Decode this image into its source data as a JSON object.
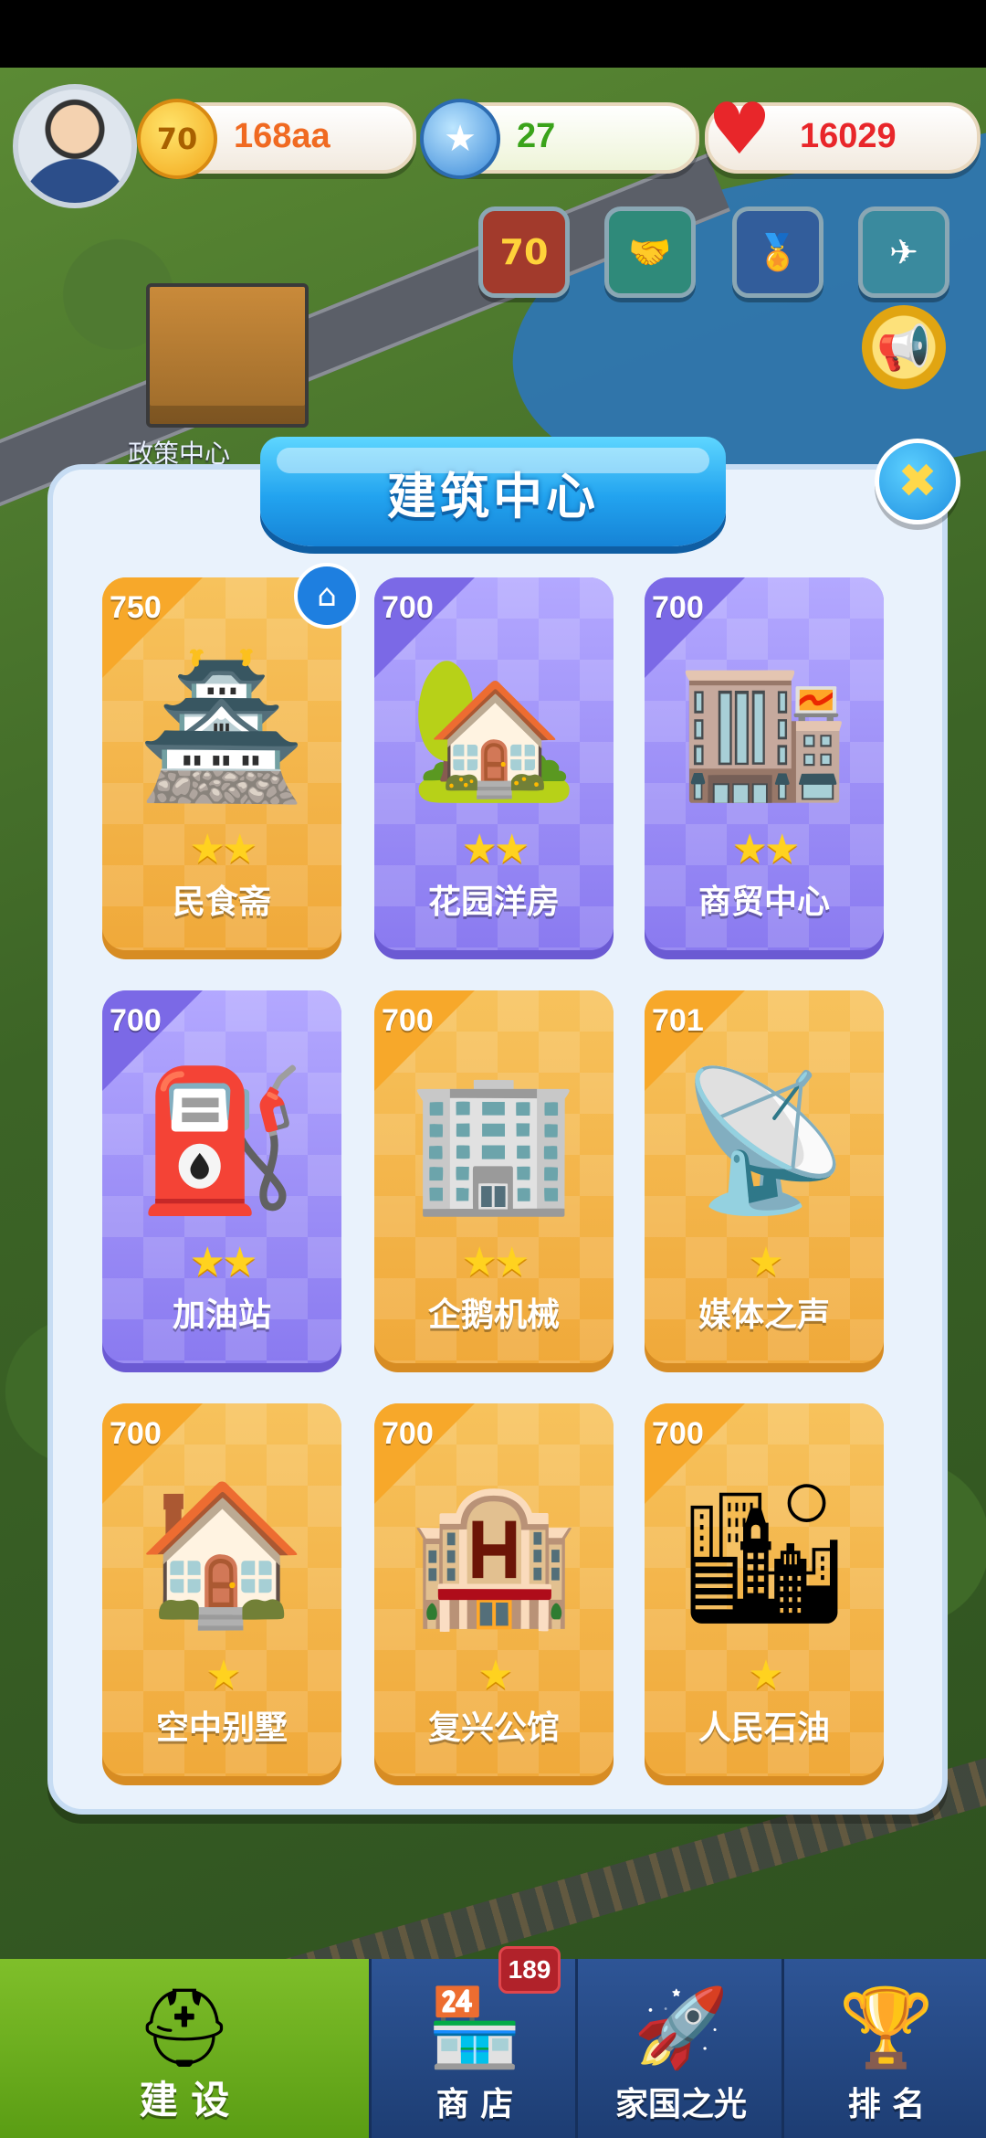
{
  "top_bar": {
    "coins": "168aa",
    "coin_icon_text": "70",
    "stars": "27",
    "hearts": "16029"
  },
  "features": [
    {
      "name": "anniversary-70",
      "text": "70"
    },
    {
      "name": "handshake",
      "text": "🤝"
    },
    {
      "name": "medal",
      "text": "🏅"
    },
    {
      "name": "airplane",
      "text": "✈"
    }
  ],
  "map": {
    "policy_center_label": "政策中心"
  },
  "panel": {
    "title": "建筑中心",
    "close_symbol": "✖",
    "home_symbol": "⌂",
    "cards": [
      {
        "cost": "750",
        "name": "民食斋",
        "stars": "★★",
        "theme": "gold",
        "owned": true,
        "art": "🏯"
      },
      {
        "cost": "700",
        "name": "花园洋房",
        "stars": "★★",
        "theme": "purple",
        "art": "🏡"
      },
      {
        "cost": "700",
        "name": "商贸中心",
        "stars": "★★",
        "theme": "purple",
        "art": "🏬"
      },
      {
        "cost": "700",
        "name": "加油站",
        "stars": "★★",
        "theme": "purple",
        "art": "⛽"
      },
      {
        "cost": "700",
        "name": "企鹅机械",
        "stars": "★★",
        "theme": "gold",
        "art": "🏢"
      },
      {
        "cost": "701",
        "name": "媒体之声",
        "stars": "★",
        "theme": "gold",
        "art": "📡"
      },
      {
        "cost": "700",
        "name": "空中别墅",
        "stars": "★",
        "theme": "gold",
        "art": "🏠"
      },
      {
        "cost": "700",
        "name": "复兴公馆",
        "stars": "★",
        "theme": "gold",
        "art": "🏨"
      },
      {
        "cost": "700",
        "name": "人民石油",
        "stars": "★",
        "theme": "gold",
        "art": "🏙"
      }
    ]
  },
  "bottom_nav": {
    "build": {
      "label": "建 设",
      "icon": "⛑"
    },
    "shop": {
      "label": "商 店",
      "icon": "🏪",
      "badge": "189"
    },
    "home": {
      "label": "家国之光",
      "icon": "🚀"
    },
    "rank": {
      "label": "排 名",
      "icon": "🏆"
    }
  },
  "colors": {
    "gold_card": "#f3b03e",
    "purple_card": "#8e7df1",
    "title_blue": "#22a3ef",
    "nav_green": "#6aad1e",
    "nav_blue": "#264a86"
  }
}
